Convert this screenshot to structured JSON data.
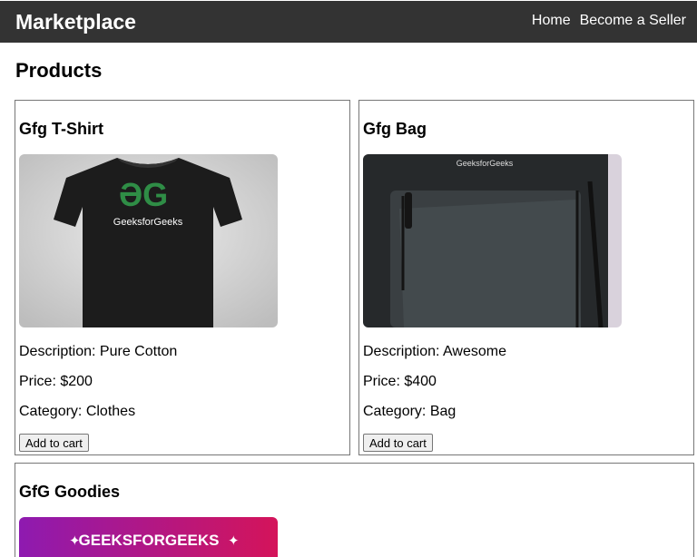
{
  "nav": {
    "brand": "Marketplace",
    "links": [
      "Home",
      "Become a Seller"
    ]
  },
  "page": {
    "title": "Products"
  },
  "products": [
    {
      "name": "Gfg T-Shirt",
      "image_text": "GeeksforGeeks",
      "description": "Description: Pure Cotton",
      "price": "Price: $200",
      "category": "Category: Clothes",
      "cart_label": "Add to cart"
    },
    {
      "name": "Gfg Bag",
      "image_text": "GeeksforGeeks",
      "description": "Description: Awesome",
      "price": "Price: $400",
      "category": "Category: Bag",
      "cart_label": "Add to cart"
    },
    {
      "name": "GfG Goodies",
      "image_text": "GEEKSFORGEEKS"
    }
  ],
  "colors": {
    "navbar": "#333333",
    "logo_green": "#2f8d46",
    "banner_start": "#8e1ab0",
    "banner_end": "#d4145a"
  }
}
